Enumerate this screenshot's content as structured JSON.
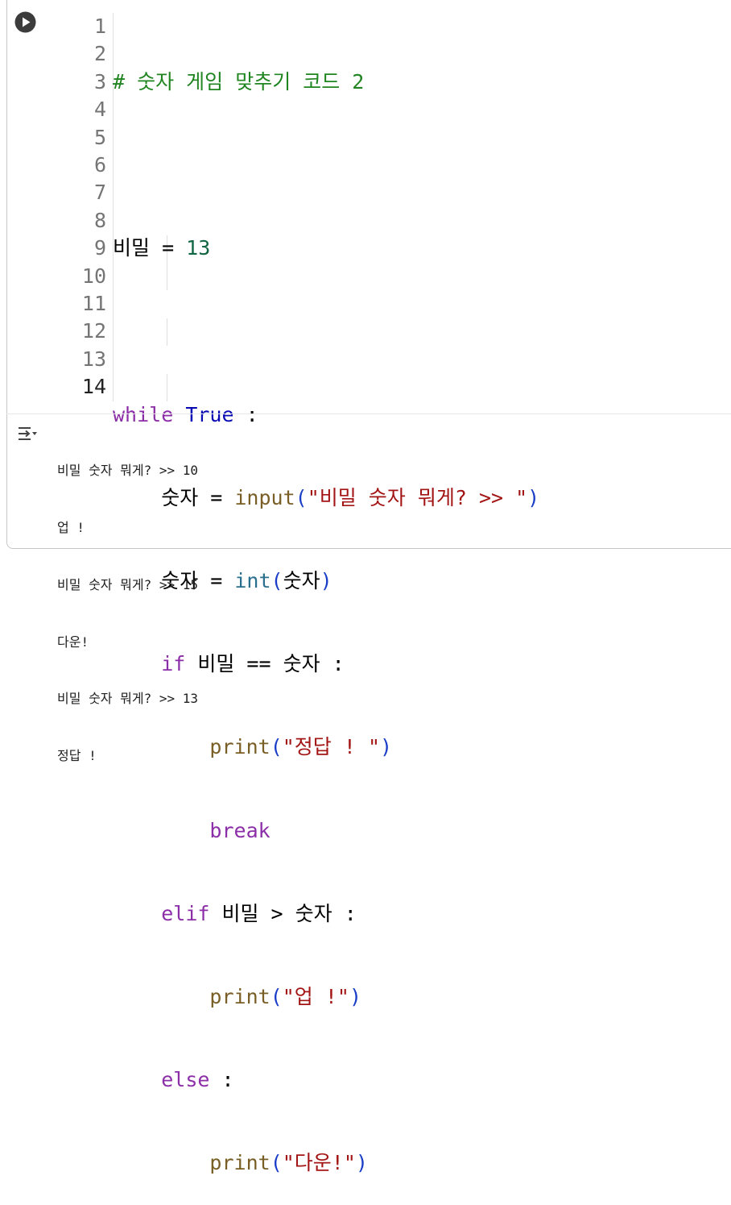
{
  "cell": {
    "run_icon": "play-circle-icon",
    "output_icon": "output-toggle-icon",
    "line_numbers": [
      "1",
      "2",
      "3",
      "4",
      "5",
      "6",
      "7",
      "8",
      "9",
      "10",
      "11",
      "12",
      "13",
      "14"
    ],
    "active_line": "14"
  },
  "code": {
    "l1_comment": "# 숫자 게임 맞추기 코드 2",
    "l3_var": "비밀",
    "l3_op": " = ",
    "l3_num": "13",
    "l5_kw": "while",
    "l5_sp": " ",
    "l5_const": "True",
    "l5_colon": " :",
    "l6_indent": "    ",
    "l6_var": "숫자 = ",
    "l6_fn": "input",
    "l6_po": "(",
    "l6_str": "\"비밀 숫자 뭐게? >> \"",
    "l6_pc": ")",
    "l7_indent": "    ",
    "l7_var": "숫자 = ",
    "l7_fn": "int",
    "l7_po": "(",
    "l7_arg": "숫자",
    "l7_pc": ")",
    "l8_indent": "    ",
    "l8_kw": "if",
    "l8_rest": " 비밀 == 숫자 :",
    "l9_indent": "        ",
    "l9_fn": "print",
    "l9_po": "(",
    "l9_str": "\"정답 ! \"",
    "l9_pc": ")",
    "l10_indent": "        ",
    "l10_kw": "break",
    "l11_indent": "    ",
    "l11_kw": "elif",
    "l11_rest": " 비밀 > 숫자 :",
    "l12_indent": "        ",
    "l12_fn": "print",
    "l12_po": "(",
    "l12_str": "\"업 !\"",
    "l12_pc": ")",
    "l13_indent": "    ",
    "l13_kw": "else",
    "l13_rest": " :",
    "l14_indent": "        ",
    "l14_fn": "print",
    "l14_po": "(",
    "l14_str": "\"다운!\"",
    "l14_pc": ")"
  },
  "output": {
    "lines": [
      "비밀 숫자 뭐게? >> 10",
      "업 !",
      "비밀 숫자 뭐게? >> 15",
      "다운!",
      "비밀 숫자 뭐게? >> 13",
      "정답 !"
    ]
  }
}
